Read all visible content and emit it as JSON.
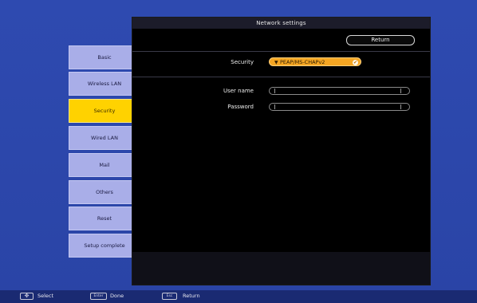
{
  "panel": {
    "title": "Network settings",
    "return_label": "Return"
  },
  "form": {
    "security_label": "Security",
    "security_value": "PEAP/MS-CHAPv2",
    "security_arrow": "▼",
    "security_ok": "✔",
    "username_label": "User name",
    "username_value": "",
    "password_label": "Password",
    "password_value": ""
  },
  "menu": {
    "items": [
      {
        "label": "Basic",
        "selected": false
      },
      {
        "label": "Wireless LAN",
        "selected": false
      },
      {
        "label": "Security",
        "selected": true
      },
      {
        "label": "Wired LAN",
        "selected": false
      },
      {
        "label": "Mail",
        "selected": false
      },
      {
        "label": "Others",
        "selected": false
      },
      {
        "label": "Reset",
        "selected": false
      },
      {
        "label": "Setup complete",
        "selected": false
      }
    ]
  },
  "helpbar": {
    "select_key": "✥",
    "select_label": "Select",
    "done_key": "Enter",
    "done_label": "Done",
    "return_key": "Esc",
    "return_label": "Return"
  },
  "colors": {
    "background": "#2b46a8",
    "selected_item": "#ffd200",
    "menu_item": "#a9aee8",
    "security_select": "#f5a623"
  }
}
